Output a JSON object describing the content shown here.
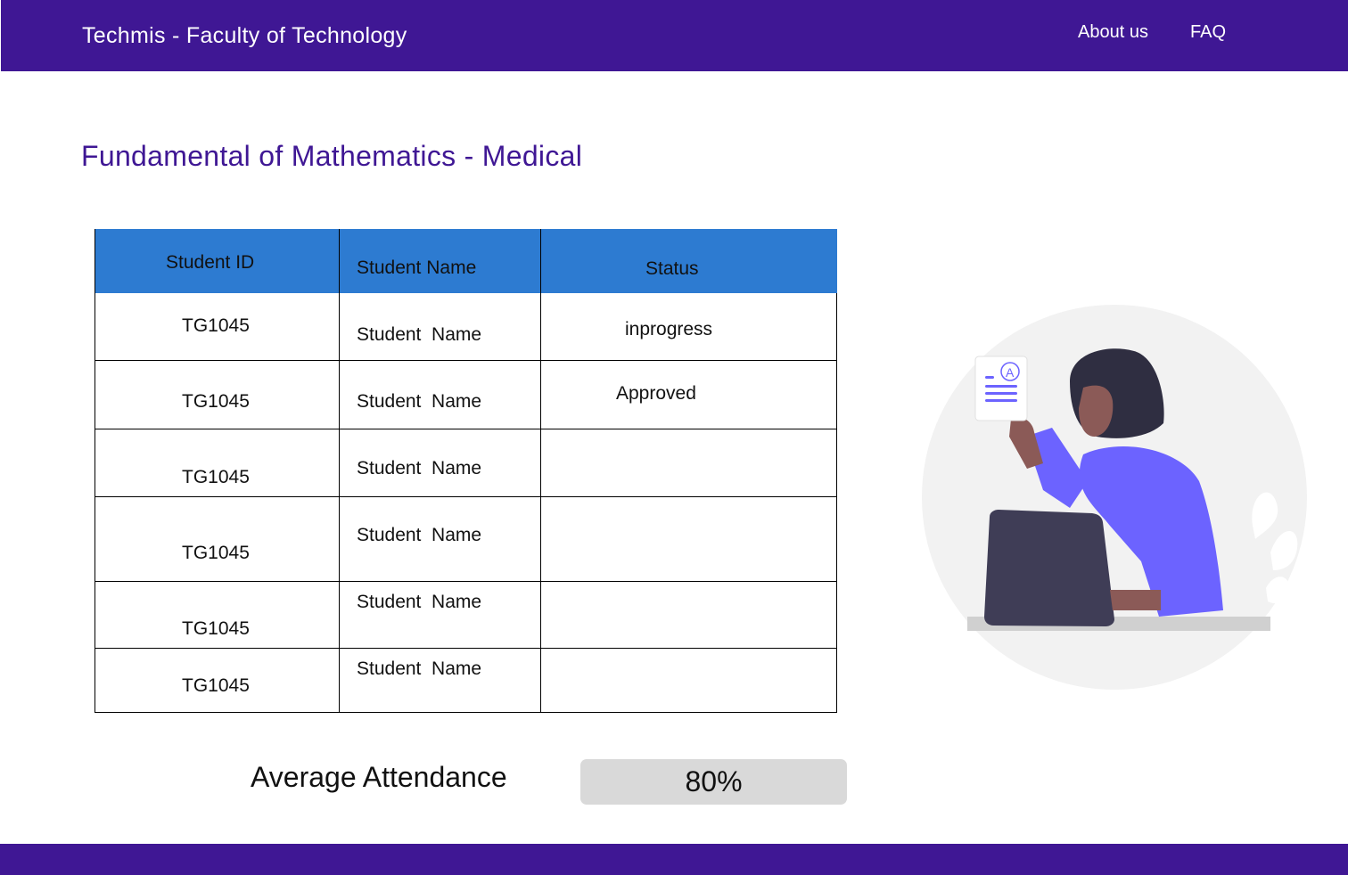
{
  "header": {
    "brand": "Techmis - Faculty of Technology",
    "nav": {
      "about": "About us",
      "faq": "FAQ"
    }
  },
  "page": {
    "title": "Fundamental of Mathematics - Medical"
  },
  "table": {
    "columns": [
      "Student  ID",
      "Student  Name",
      "Status"
    ],
    "rows": [
      {
        "id": "TG1045",
        "name": "Student  Name",
        "status": "inprogress"
      },
      {
        "id": "TG1045",
        "name": "Student  Name",
        "status": "Approved"
      },
      {
        "id": "TG1045",
        "name": "Student  Name",
        "status": ""
      },
      {
        "id": "TG1045",
        "name": "Student  Name",
        "status": ""
      },
      {
        "id": "TG1045",
        "name": "Student  Name",
        "status": ""
      },
      {
        "id": "TG1045",
        "name": "Student  Name",
        "status": ""
      }
    ]
  },
  "attendance": {
    "label": "Average Attendance",
    "value": "80%"
  },
  "illustration": {
    "icon": "student-with-laptop-illustration",
    "badge_letter": "A"
  },
  "colors": {
    "brand": "#3f1794",
    "table_header": "#2d7bd1",
    "accent": "#6c63ff"
  }
}
